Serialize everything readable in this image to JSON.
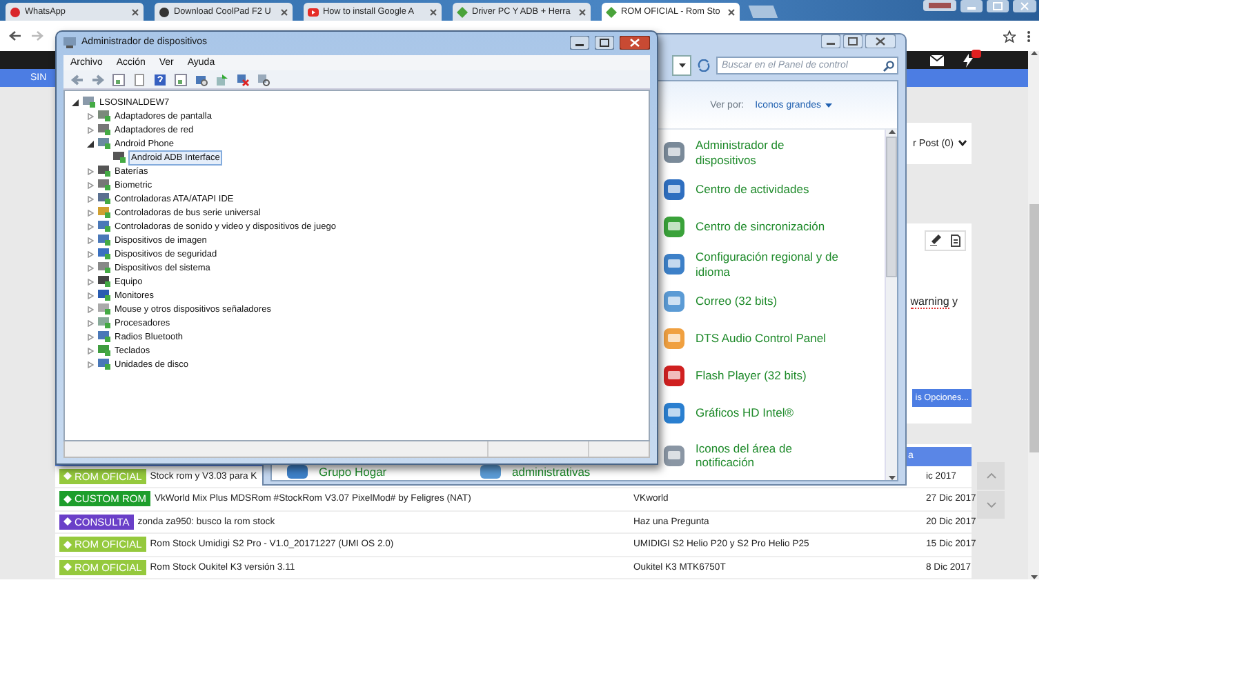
{
  "browser": {
    "tabs": [
      {
        "title": "WhatsApp",
        "selected": false
      },
      {
        "title": "Download CoolPad F2 U",
        "selected": false
      },
      {
        "title": "How to install Google A",
        "selected": false
      },
      {
        "title": "Driver PC Y ADB + Herra",
        "selected": false
      },
      {
        "title": "ROM OFICIAL - Rom Sto",
        "selected": true
      }
    ]
  },
  "site": {
    "nav_text": "SIN",
    "post_menu": "r Post (0)",
    "editor_words": [
      {
        "text": "warning",
        "misspelled": true
      },
      {
        "text": "y",
        "misspelled": false
      }
    ],
    "options_button": "is Opciones...",
    "list_header": "a",
    "threads": [
      {
        "tag": {
          "label": "ROM OFICIAL",
          "color": "#95c93d"
        },
        "title": "Stock rom y V3.03 para K",
        "date": "ic 2017"
      },
      {
        "tag": {
          "label": "CUSTOM ROM",
          "color": "#1e9e2c"
        },
        "title": "VkWorld Mix Plus MDSRom #StockRom V3.07 PixelMod# by Feligres (NAT)",
        "forum": "VKworld",
        "date": "27 Dic 2017"
      },
      {
        "tag": {
          "label": "CONSULTA",
          "color": "#6a3fc8"
        },
        "title": "zonda za950: busco la rom stock",
        "forum": "Haz una Pregunta",
        "date": "20 Dic 2017"
      },
      {
        "tag": {
          "label": "ROM OFICIAL",
          "color": "#95c93d"
        },
        "title": "Rom Stock Umidigi S2 Pro - V1.0_20171227 (UMI OS 2.0)",
        "forum": "UMIDIGI S2 Helio P20 y S2 Pro Helio P25",
        "date": "15 Dic 2017"
      },
      {
        "tag": {
          "label": "ROM OFICIAL",
          "color": "#95c93d"
        },
        "title": "Rom Stock Oukitel K3 versión 3.11",
        "forum": "Oukitel K3 MTK6750T",
        "date": "8 Dic 2017"
      }
    ]
  },
  "control_panel": {
    "search_placeholder": "Buscar en el Panel de control",
    "view_label": "Ver por:",
    "view_value": "Iconos grandes",
    "items": [
      {
        "label": "Administrador de dispositivos"
      },
      {
        "label": "Centro de actividades"
      },
      {
        "label": "Centro de sincronización"
      },
      {
        "label": "Configuración regional y de idioma"
      },
      {
        "label": "Correo (32 bits)"
      },
      {
        "label": "DTS Audio Control Panel"
      },
      {
        "label": "Flash Player (32 bits)"
      },
      {
        "label": "Gráficos HD Intel®"
      },
      {
        "label": "Iconos del área de notificación"
      }
    ],
    "partial_items": [
      {
        "label": "Grupo Hogar"
      },
      {
        "label": "administrativas"
      }
    ]
  },
  "device_manager": {
    "title": "Administrador de dispositivos",
    "menu": [
      "Archivo",
      "Acción",
      "Ver",
      "Ayuda"
    ],
    "tree": [
      {
        "label": "LSOSINALDEW7",
        "expanded": true,
        "selected": false,
        "children": [
          {
            "label": "Adaptadores de pantalla",
            "expanded": false,
            "selected": false
          },
          {
            "label": "Adaptadores de red",
            "expanded": false,
            "selected": false
          },
          {
            "label": "Android Phone",
            "expanded": true,
            "selected": false,
            "children": [
              {
                "label": "Android ADB Interface",
                "selected": true
              }
            ]
          },
          {
            "label": "Baterías",
            "expanded": false,
            "selected": false
          },
          {
            "label": "Biometric",
            "expanded": false,
            "selected": false
          },
          {
            "label": "Controladoras ATA/ATAPI IDE",
            "expanded": false,
            "selected": false
          },
          {
            "label": "Controladoras de bus serie universal",
            "expanded": false,
            "selected": false
          },
          {
            "label": "Controladoras de sonido y video y dispositivos de juego",
            "expanded": false,
            "selected": false
          },
          {
            "label": "Dispositivos de imagen",
            "expanded": false,
            "selected": false
          },
          {
            "label": "Dispositivos de seguridad",
            "expanded": false,
            "selected": false
          },
          {
            "label": "Dispositivos del sistema",
            "expanded": false,
            "selected": false
          },
          {
            "label": "Equipo",
            "expanded": false,
            "selected": false
          },
          {
            "label": "Monitores",
            "expanded": false,
            "selected": false
          },
          {
            "label": "Mouse y otros dispositivos señaladores",
            "expanded": false,
            "selected": false
          },
          {
            "label": "Procesadores",
            "expanded": false,
            "selected": false
          },
          {
            "label": "Radios Bluetooth",
            "expanded": false,
            "selected": false
          },
          {
            "label": "Teclados",
            "expanded": false,
            "selected": false
          },
          {
            "label": "Unidades de disco",
            "expanded": false,
            "selected": false
          }
        ]
      }
    ]
  }
}
